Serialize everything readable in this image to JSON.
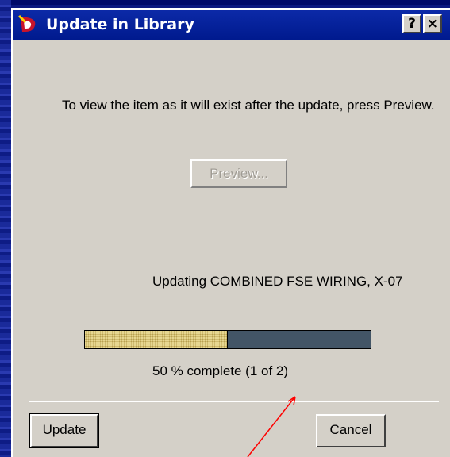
{
  "dialog": {
    "title": "Update in Library",
    "help_label": "?",
    "close_label": "×",
    "instruction": "To view the item as it will exist after the update, press Preview.",
    "preview_label": "Preview...",
    "updating_text": "Updating  COMBINED FSE WIRING, X-07",
    "progress": {
      "percent": 50,
      "text": "50 % complete (1  of  2)"
    },
    "update_label": "Update",
    "cancel_label": "Cancel"
  },
  "colors": {
    "annotation_arrow": "#ff0000",
    "title_bar": "#0c2aa8",
    "progress_fill": "#e6d690",
    "progress_track": "#435566"
  }
}
